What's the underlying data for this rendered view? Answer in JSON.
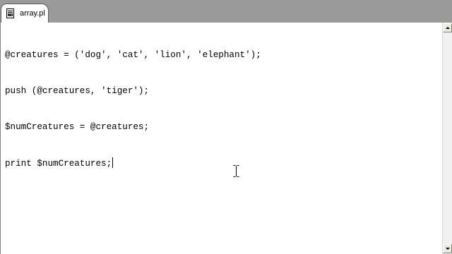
{
  "tab": {
    "filename": "array.pl",
    "icon": "perl-file-icon"
  },
  "editor": {
    "lines": [
      "@creatures = ('dog', 'cat', 'lion', 'elephant');",
      "push (@creatures, 'tiger');",
      "$numCreatures = @creatures;",
      "print $numCreatures;"
    ]
  },
  "colors": {
    "tabbar_background": "#9a9a9a",
    "editor_background": "#ffffff",
    "text": "#000000"
  }
}
